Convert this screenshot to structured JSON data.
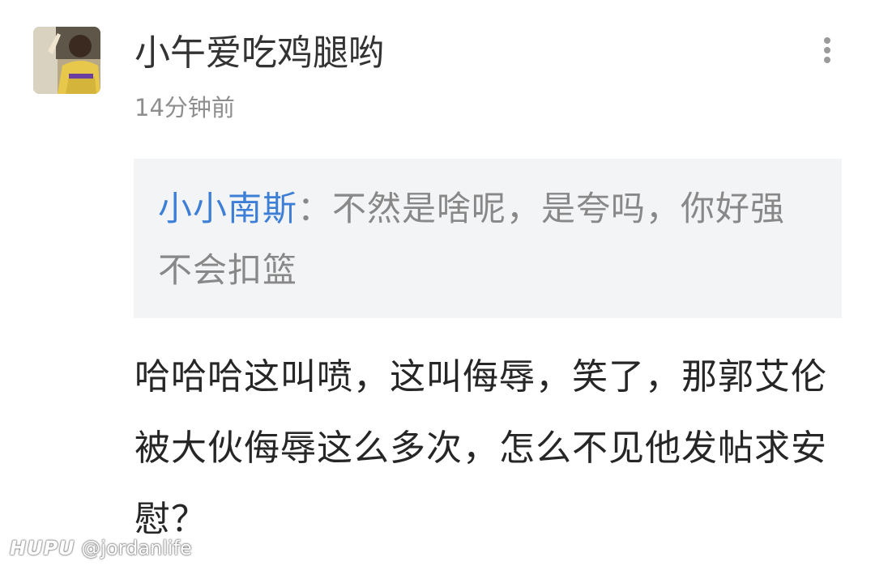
{
  "post": {
    "username": "小午爱吃鸡腿哟",
    "timestamp": "14分钟前",
    "quote": {
      "author": "小小南斯",
      "separator": "：",
      "text": "不然是啥呢，是夸吗，你好强不会扣篮"
    },
    "body": "哈哈哈这叫喷，这叫侮辱，笑了，那郭艾伦被大伙侮辱这么多次，怎么不见他发帖求安慰？"
  },
  "watermark": {
    "brand": "HUPU",
    "handle": "@jordanlife"
  },
  "icons": {
    "more": "more-vertical-icon",
    "avatar": "user-avatar-image"
  },
  "colors": {
    "quote_author": "#3d7fd6",
    "quote_background": "#f3f4f6",
    "primary_text": "#262626",
    "secondary_text": "#8e8e8e"
  }
}
